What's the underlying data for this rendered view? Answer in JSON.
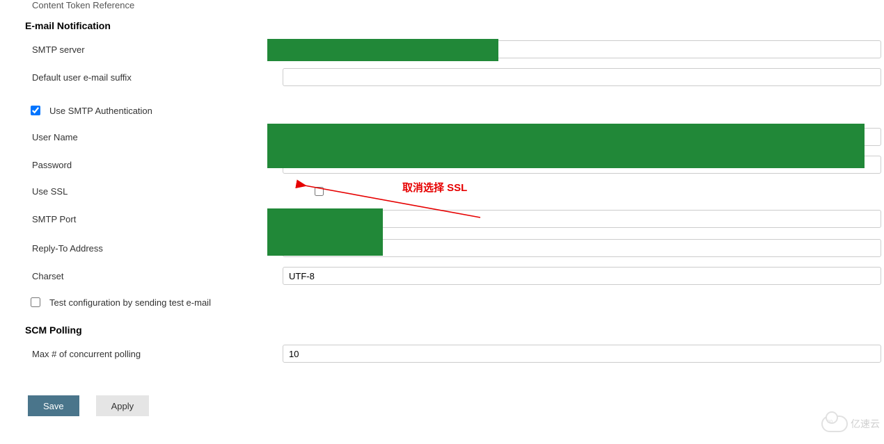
{
  "prev_item": "Content Token Reference",
  "sections": {
    "email": "E-mail Notification",
    "scm": "SCM Polling"
  },
  "labels": {
    "smtp_server": "SMTP server",
    "default_suffix": "Default user e-mail suffix",
    "use_smtp_auth": "Use SMTP Authentication",
    "user_name": "User Name",
    "password": "Password",
    "use_ssl": "Use SSL",
    "smtp_port": "SMTP Port",
    "reply_to": "Reply-To Address",
    "charset": "Charset",
    "test_config": "Test configuration by sending test e-mail",
    "max_polling": "Max # of concurrent polling"
  },
  "values": {
    "smtp_server": "",
    "default_suffix": "",
    "user_name": "",
    "password": "",
    "use_smtp_auth_checked": true,
    "use_ssl_checked": false,
    "smtp_port": "",
    "reply_to": "",
    "charset": "UTF-8",
    "test_config_checked": false,
    "max_polling": "10"
  },
  "annotations": {
    "ssl_note": "取消选择 SSL"
  },
  "buttons": {
    "save": "Save",
    "apply": "Apply"
  },
  "watermark": "亿速云"
}
